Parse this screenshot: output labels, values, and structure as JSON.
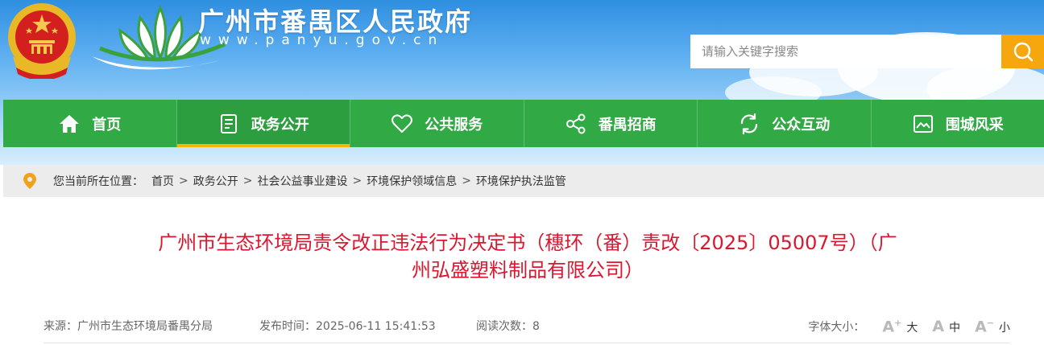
{
  "header": {
    "site_title": "广州市番禺区人民政府",
    "site_domain": "www.panyu.gov.cn",
    "search": {
      "placeholder": "请输入关键字搜索"
    }
  },
  "nav": {
    "items": [
      {
        "label": "首页",
        "icon": "home-icon"
      },
      {
        "label": "政务公开",
        "icon": "document-list-icon",
        "active": true
      },
      {
        "label": "公共服务",
        "icon": "heart-icon"
      },
      {
        "label": "番禺招商",
        "icon": "share-nodes-icon"
      },
      {
        "label": "公众互动",
        "icon": "refresh-icon"
      },
      {
        "label": "围城风采",
        "icon": "picture-icon"
      }
    ]
  },
  "breadcrumb": {
    "prefix": "您当前所在位置：",
    "items": [
      "首页",
      "政务公开",
      "社会公益事业建设",
      "环境保护领域信息",
      "环境保护执法监管"
    ],
    "separator": ">"
  },
  "article": {
    "title_line1": "广州市生态环境局责令改正违法行为决定书（穗环（番）责改〔2025〕05007号）（广",
    "title_line2": "州弘盛塑料制品有限公司）",
    "meta": {
      "source": "来源：广州市生态环境局番禺分局",
      "published": "发布时间：2025-06-11 15:41:53",
      "views": "阅读次数：8"
    },
    "font_size": {
      "label": "字体大小：",
      "large": "大",
      "medium": "中",
      "small": "小"
    }
  },
  "colors": {
    "nav_green": "#31a944",
    "accent_orange": "#f5a70d",
    "active_underline": "#f5b40d",
    "title_red": "#d9182f"
  }
}
